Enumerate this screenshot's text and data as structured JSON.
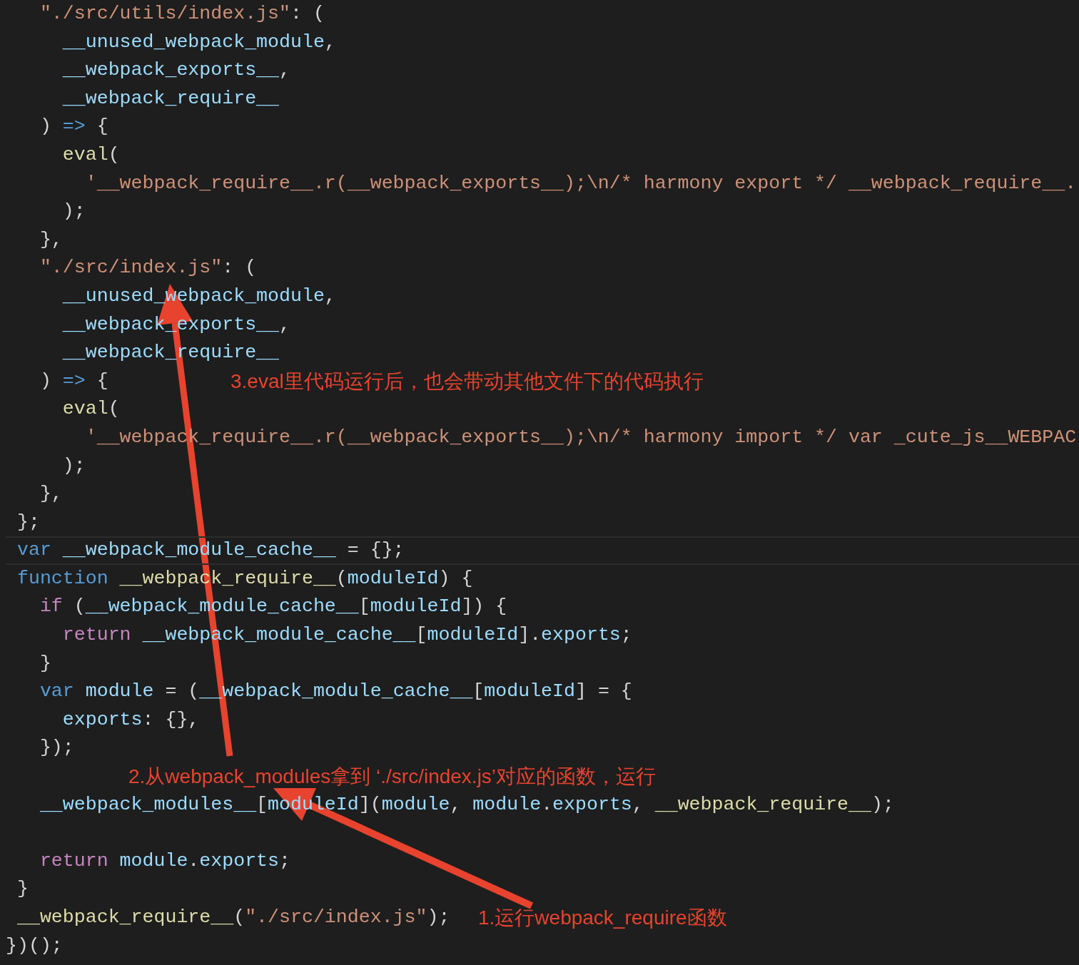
{
  "editor": {
    "lines": [
      {
        "kind": "code",
        "tokens": [
          {
            "kind": "string",
            "text": "   \"./src/utils/index.js\""
          },
          {
            "kind": "plain",
            "text": ": ("
          }
        ]
      },
      {
        "kind": "code",
        "tokens": [
          {
            "kind": "variable",
            "text": "     __unused_webpack_module"
          },
          {
            "kind": "plain",
            "text": ","
          }
        ]
      },
      {
        "kind": "code",
        "tokens": [
          {
            "kind": "variable",
            "text": "     __webpack_exports__"
          },
          {
            "kind": "plain",
            "text": ","
          }
        ]
      },
      {
        "kind": "code",
        "tokens": [
          {
            "kind": "variable",
            "text": "     __webpack_require__"
          }
        ]
      },
      {
        "kind": "code",
        "tokens": [
          {
            "kind": "plain",
            "text": "   ) "
          },
          {
            "kind": "keyword",
            "text": "=>"
          },
          {
            "kind": "plain",
            "text": " {"
          }
        ]
      },
      {
        "kind": "code",
        "tokens": [
          {
            "kind": "function",
            "text": "     eval"
          },
          {
            "kind": "plain",
            "text": "("
          }
        ]
      },
      {
        "kind": "code",
        "tokens": [
          {
            "kind": "string",
            "text": "       '__webpack_require__.r(__webpack_exports__);\\n/* harmony export */ __webpack_require__."
          }
        ]
      },
      {
        "kind": "code",
        "tokens": [
          {
            "kind": "plain",
            "text": "     );"
          }
        ]
      },
      {
        "kind": "code",
        "tokens": [
          {
            "kind": "plain",
            "text": "   },"
          }
        ]
      },
      {
        "kind": "code",
        "tokens": [
          {
            "kind": "string",
            "text": "   \"./src/index.js\""
          },
          {
            "kind": "plain",
            "text": ": ("
          }
        ]
      },
      {
        "kind": "code",
        "tokens": [
          {
            "kind": "variable",
            "text": "     __unused_webpack_module"
          },
          {
            "kind": "plain",
            "text": ","
          }
        ]
      },
      {
        "kind": "code",
        "tokens": [
          {
            "kind": "variable",
            "text": "     __webpack_exports__"
          },
          {
            "kind": "plain",
            "text": ","
          }
        ]
      },
      {
        "kind": "code",
        "tokens": [
          {
            "kind": "variable",
            "text": "     __webpack_require__"
          }
        ]
      },
      {
        "kind": "code",
        "tokens": [
          {
            "kind": "plain",
            "text": "   ) "
          },
          {
            "kind": "keyword",
            "text": "=>"
          },
          {
            "kind": "plain",
            "text": " {"
          }
        ],
        "note": "3.eval里代码运行后，也会带动其他文件下的代码执行"
      },
      {
        "kind": "code",
        "tokens": [
          {
            "kind": "function",
            "text": "     eval"
          },
          {
            "kind": "plain",
            "text": "("
          }
        ]
      },
      {
        "kind": "code",
        "tokens": [
          {
            "kind": "string",
            "text": "       '__webpack_require__.r(__webpack_exports__);\\n/* harmony import */ var _cute_js__WEBPAC"
          }
        ]
      },
      {
        "kind": "code",
        "tokens": [
          {
            "kind": "plain",
            "text": "     );"
          }
        ]
      },
      {
        "kind": "code",
        "tokens": [
          {
            "kind": "plain",
            "text": "   },"
          }
        ]
      },
      {
        "kind": "code",
        "tokens": [
          {
            "kind": "plain",
            "text": " };"
          }
        ]
      },
      {
        "kind": "code",
        "highlighted": true,
        "tokens": [
          {
            "kind": "keyword",
            "text": " var"
          },
          {
            "kind": "variable",
            "text": " __webpack_module_cache__"
          },
          {
            "kind": "plain",
            "text": " = {};"
          }
        ]
      },
      {
        "kind": "code",
        "tokens": [
          {
            "kind": "keyword",
            "text": " function"
          },
          {
            "kind": "function",
            "text": " __webpack_require__"
          },
          {
            "kind": "plain",
            "text": "("
          },
          {
            "kind": "variable",
            "text": "moduleId"
          },
          {
            "kind": "plain",
            "text": ") {"
          }
        ]
      },
      {
        "kind": "code",
        "tokens": [
          {
            "kind": "control",
            "text": "   if"
          },
          {
            "kind": "plain",
            "text": " ("
          },
          {
            "kind": "variable",
            "text": "__webpack_module_cache__"
          },
          {
            "kind": "plain",
            "text": "["
          },
          {
            "kind": "variable",
            "text": "moduleId"
          },
          {
            "kind": "plain",
            "text": "]) {"
          }
        ]
      },
      {
        "kind": "code",
        "tokens": [
          {
            "kind": "control",
            "text": "     return"
          },
          {
            "kind": "variable",
            "text": " __webpack_module_cache__"
          },
          {
            "kind": "plain",
            "text": "["
          },
          {
            "kind": "variable",
            "text": "moduleId"
          },
          {
            "kind": "plain",
            "text": "]."
          },
          {
            "kind": "variable",
            "text": "exports"
          },
          {
            "kind": "plain",
            "text": ";"
          }
        ]
      },
      {
        "kind": "code",
        "tokens": [
          {
            "kind": "plain",
            "text": "   }"
          }
        ]
      },
      {
        "kind": "code",
        "tokens": [
          {
            "kind": "keyword",
            "text": "   var"
          },
          {
            "kind": "variable",
            "text": " module"
          },
          {
            "kind": "plain",
            "text": " = ("
          },
          {
            "kind": "variable",
            "text": "__webpack_module_cache__"
          },
          {
            "kind": "plain",
            "text": "["
          },
          {
            "kind": "variable",
            "text": "moduleId"
          },
          {
            "kind": "plain",
            "text": "] = {"
          }
        ]
      },
      {
        "kind": "code",
        "tokens": [
          {
            "kind": "variable",
            "text": "     exports"
          },
          {
            "kind": "plain",
            "text": ": {},"
          }
        ]
      },
      {
        "kind": "code",
        "tokens": [
          {
            "kind": "plain",
            "text": "   });"
          }
        ]
      },
      {
        "kind": "blank",
        "note": "2.从webpack_modules拿到 ‘./src/index.js’对应的函数，运行"
      },
      {
        "kind": "code",
        "tokens": [
          {
            "kind": "variable",
            "text": "   __webpack_modules__"
          },
          {
            "kind": "plain",
            "text": "["
          },
          {
            "kind": "variable",
            "text": "moduleId"
          },
          {
            "kind": "plain",
            "text": "]("
          },
          {
            "kind": "variable",
            "text": "module"
          },
          {
            "kind": "plain",
            "text": ", "
          },
          {
            "kind": "variable",
            "text": "module"
          },
          {
            "kind": "plain",
            "text": "."
          },
          {
            "kind": "variable",
            "text": "exports"
          },
          {
            "kind": "plain",
            "text": ", "
          },
          {
            "kind": "function",
            "text": "__webpack_require__"
          },
          {
            "kind": "plain",
            "text": ");"
          }
        ]
      },
      {
        "kind": "blank"
      },
      {
        "kind": "code",
        "tokens": [
          {
            "kind": "control",
            "text": "   return"
          },
          {
            "kind": "variable",
            "text": " module"
          },
          {
            "kind": "plain",
            "text": "."
          },
          {
            "kind": "variable",
            "text": "exports"
          },
          {
            "kind": "plain",
            "text": ";"
          }
        ]
      },
      {
        "kind": "code",
        "tokens": [
          {
            "kind": "plain",
            "text": " }"
          }
        ]
      },
      {
        "kind": "code",
        "tokens": [
          {
            "kind": "function",
            "text": " __webpack_require__"
          },
          {
            "kind": "plain",
            "text": "("
          },
          {
            "kind": "string",
            "text": "\"./src/index.js\""
          },
          {
            "kind": "plain",
            "text": ");"
          }
        ],
        "note": "1.运行webpack_require函数"
      },
      {
        "kind": "code",
        "tokens": [
          {
            "kind": "plain",
            "text": "})();"
          }
        ]
      }
    ]
  }
}
